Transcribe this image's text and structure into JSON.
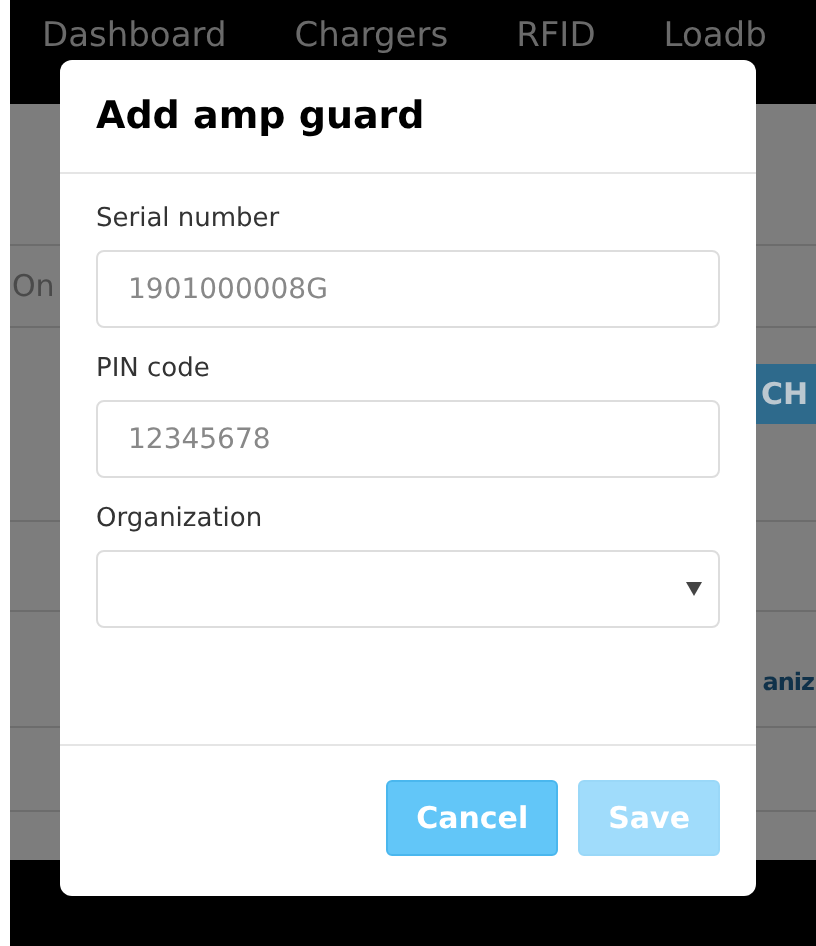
{
  "nav": {
    "items": [
      "Dashboard",
      "Chargers",
      "RFID",
      "Loadb"
    ]
  },
  "background": {
    "row_text": "On",
    "button": "CH",
    "link": "aniz"
  },
  "dialog": {
    "title": "Add amp guard",
    "fields": [
      {
        "kind": "input",
        "label": "Serial number",
        "placeholder": "1901000008G"
      },
      {
        "kind": "input",
        "label": "PIN code",
        "placeholder": "12345678"
      },
      {
        "kind": "select",
        "label": "Organization"
      }
    ],
    "buttons": [
      {
        "label": "Cancel",
        "disabled": false
      },
      {
        "label": "Save",
        "disabled": true
      }
    ]
  }
}
